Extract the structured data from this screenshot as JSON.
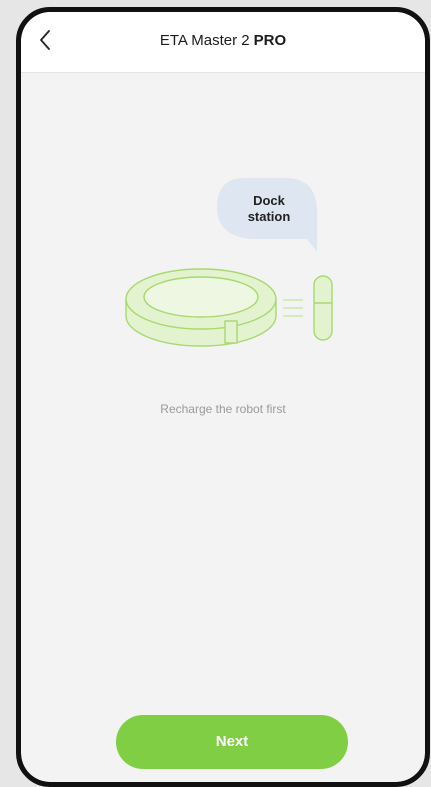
{
  "header": {
    "back_icon": "chevron-left-icon",
    "title": "ETA Master 2",
    "title_suffix": "PRO"
  },
  "illustration": {
    "bubble_label_line1": "Dock",
    "bubble_label_line2": "station",
    "robot_icon": "robot-vacuum-icon",
    "dock_icon": "dock-station-icon"
  },
  "caption": "Recharge the robot first",
  "next_button": {
    "label": "Next"
  },
  "colors": {
    "accent": "#7fce43",
    "illustration_stroke": "#a7d96e",
    "illustration_fill": "#e3f2cf",
    "bubble": "#dde6f1",
    "background": "#f3f3f3"
  }
}
